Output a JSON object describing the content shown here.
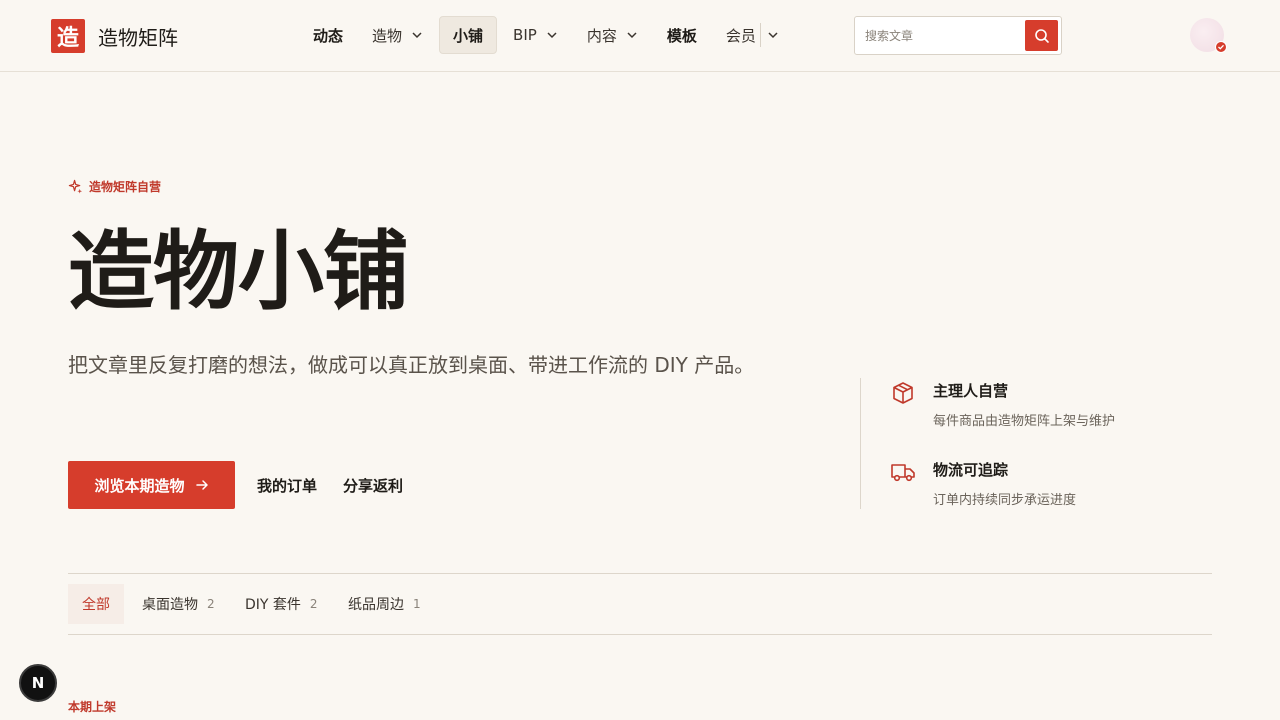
{
  "brand": {
    "logo_char": "造",
    "name": "造物矩阵"
  },
  "nav": {
    "items": [
      {
        "label": "动态"
      },
      {
        "label": "造物"
      },
      {
        "label": "小铺"
      },
      {
        "label": "BIP"
      },
      {
        "label": "内容"
      },
      {
        "label": "模板"
      },
      {
        "label": "会员"
      }
    ]
  },
  "search": {
    "placeholder": "搜索文章"
  },
  "hero": {
    "eyebrow": "造物矩阵自营",
    "title": "造物小铺",
    "description": "把文章里反复打磨的想法，做成可以真正放到桌面、带进工作流的 DIY 产品。",
    "cta_label": "浏览本期造物",
    "orders_label": "我的订单",
    "share_label": "分享返利"
  },
  "features": [
    {
      "title": "主理人自营",
      "subtitle": "每件商品由造物矩阵上架与维护",
      "icon": "package-icon"
    },
    {
      "title": "物流可追踪",
      "subtitle": "订单内持续同步承运进度",
      "icon": "truck-icon"
    }
  ],
  "tabs": [
    {
      "label": "全部",
      "count": ""
    },
    {
      "label": "桌面造物",
      "count": "2"
    },
    {
      "label": "DIY 套件",
      "count": "2"
    },
    {
      "label": "纸品周边",
      "count": "1"
    }
  ],
  "section": {
    "label": "本期上架"
  },
  "fab": {
    "label": "N"
  },
  "colors": {
    "accent": "#d63d2c",
    "background": "#faf7f2"
  }
}
